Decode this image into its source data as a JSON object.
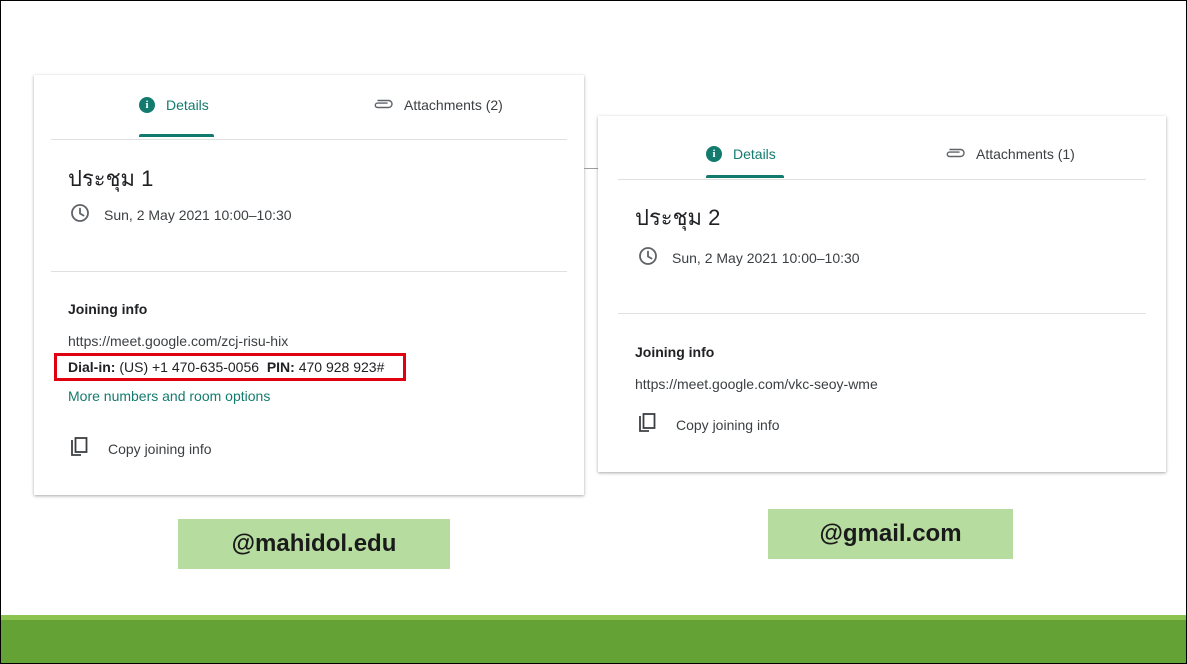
{
  "cards": [
    {
      "tabs": {
        "details_label": "Details",
        "attachments_label": "Attachments (2)"
      },
      "title": "ประชุม 1",
      "datetime": "Sun, 2 May 2021 10:00–10:30",
      "joining_heading": "Joining info",
      "meet_url": "https://meet.google.com/zcj-risu-hix",
      "dialin_label": "Dial-in:",
      "dialin_number": "(US) +1 470-635-0056",
      "pin_label": "PIN:",
      "pin_value": "470 928 923#",
      "more_link": "More numbers and room options",
      "copy_label": "Copy joining info",
      "account": "@mahidol.edu"
    },
    {
      "tabs": {
        "details_label": "Details",
        "attachments_label": "Attachments (1)"
      },
      "title": "ประชุม 2",
      "datetime": "Sun, 2 May 2021 10:00–10:30",
      "joining_heading": "Joining info",
      "meet_url": "https://meet.google.com/vkc-seoy-wme",
      "copy_label": "Copy joining info",
      "account": "@gmail.com"
    }
  ],
  "colors": {
    "accent": "#137b6e",
    "highlight_border": "#e0000f",
    "label_bg": "#b7dca0",
    "footer_green": "#64a236",
    "footer_stripe": "#8cc34f"
  },
  "icons": [
    "info-icon",
    "paperclip-icon",
    "clock-icon",
    "copy-icon"
  ]
}
